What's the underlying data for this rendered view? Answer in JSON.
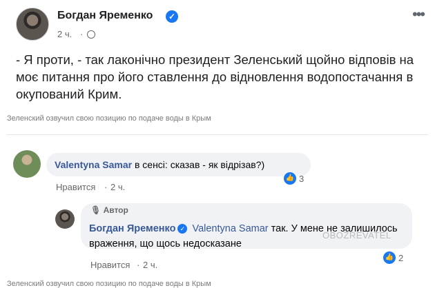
{
  "post": {
    "author": "Богдан Яременко",
    "time": "2 ч.",
    "dot": "·",
    "text": "- Я проти, - так лаконічно президент Зеленський щойно відповів на моє питання про його ставлення до відновлення водопостачання в окупований Крим."
  },
  "captions": {
    "top": "Зеленский озвучил свою позицию по подаче воды в Крым",
    "bottom": "Зеленский озвучил свою позицию по подаче воды в Крым"
  },
  "comment1": {
    "author": "Valentyna Samar",
    "text": "в сенсі: сказав - як відрізав?)",
    "like_label": "Нравится",
    "sep": "·",
    "time": "2 ч.",
    "reactions": "3"
  },
  "reply": {
    "badge": "Автор",
    "author": "Богдан Яременко",
    "mention": "Valentyna Samar",
    "text": "так. У мене не залишилось враження, що щось недосказане",
    "like_label": "Нравится",
    "sep": "·",
    "time": "2 ч.",
    "reactions": "2"
  },
  "watermark": "OBOZREVATEL",
  "colors": {
    "accent": "#1877f2",
    "name_link": "#385898",
    "bubble": "#f0f2f5"
  },
  "icons": {
    "verified": "verified-check-icon",
    "globe": "globe-icon",
    "more": "more-options-icon",
    "like": "like-reaction-icon",
    "author_badge": "microphone-icon"
  }
}
